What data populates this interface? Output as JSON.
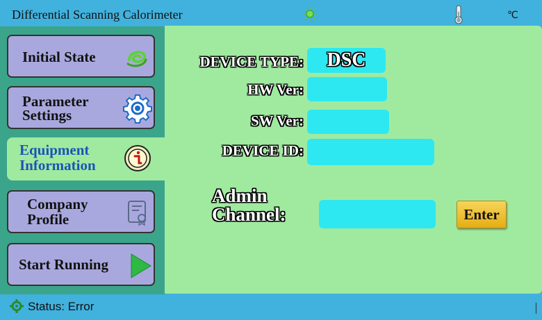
{
  "app": {
    "title": "Differential Scanning Calorimeter",
    "temp_unit": "℃"
  },
  "sidebar": {
    "items": [
      {
        "label_line1": "Initial State",
        "label_line2": "",
        "icon": "swirl-icon",
        "active": false
      },
      {
        "label_line1": "Parameter",
        "label_line2": "Settings",
        "icon": "gear-icon",
        "active": false
      },
      {
        "label_line1": "Equipment",
        "label_line2": "Information",
        "icon": "info-icon",
        "active": true
      },
      {
        "label_line1": "Company",
        "label_line2": "Profile",
        "icon": "certificate-icon",
        "active": false
      },
      {
        "label_line1": "Start Running",
        "label_line2": "",
        "icon": "play-icon",
        "active": false
      }
    ]
  },
  "device": {
    "type_label": "DEVICE TYPE:",
    "type_value": "DSC",
    "hw_label": "HW Ver:",
    "hw_value": "",
    "sw_label": "SW Ver:",
    "sw_value": "",
    "id_label": "DEVICE ID:",
    "id_value": ""
  },
  "admin": {
    "label_line1": "Admin",
    "label_line2": "Channel:",
    "value": "",
    "enter_label": "Enter"
  },
  "status": {
    "text": "Status: Error"
  },
  "colors": {
    "bar_blue": "#41b1de",
    "panel_green": "#a0eaa0",
    "sidebar_teal": "#3aa58a",
    "button_lavender": "#a9a8de",
    "field_cyan": "#2de8f0",
    "enter_gold": "#f0c030",
    "active_text": "#1d53b8"
  }
}
